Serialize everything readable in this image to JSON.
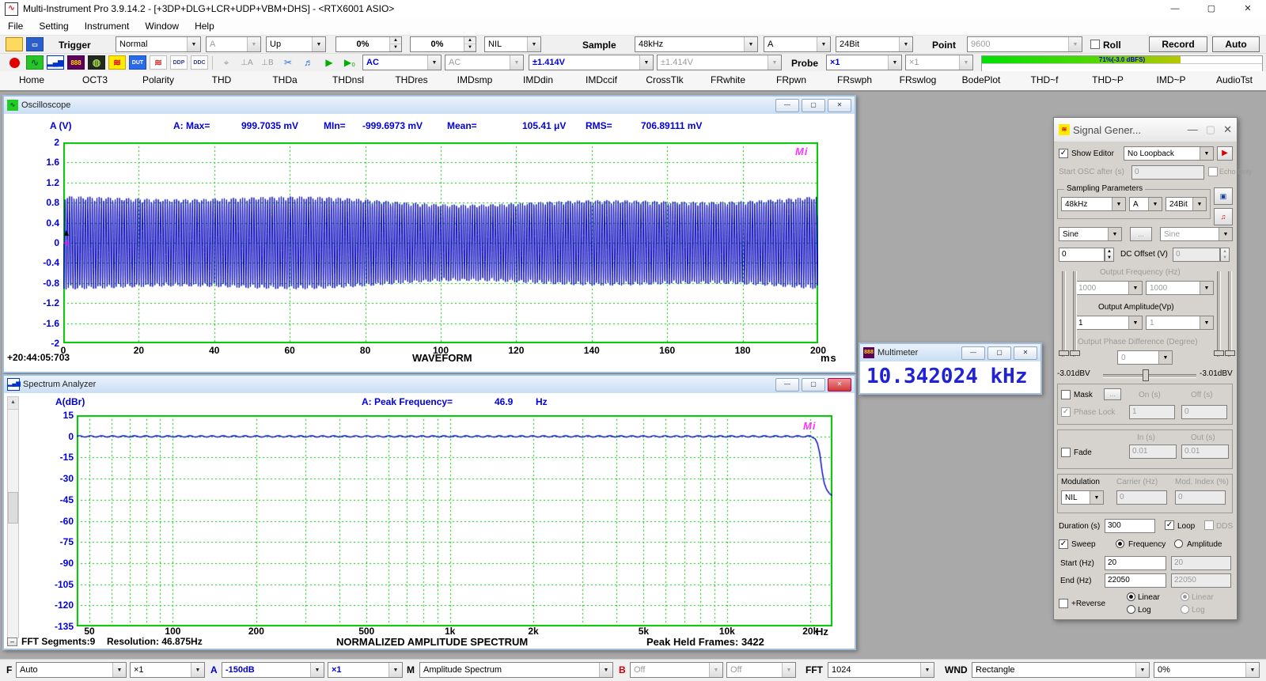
{
  "titlebar": {
    "title": "Multi-Instrument Pro 3.9.14.2  -  [+3DP+DLG+LCR+UDP+VBM+DHS]  -  <RTX6001 ASIO>"
  },
  "menu": {
    "items": [
      "File",
      "Setting",
      "Instrument",
      "Window",
      "Help"
    ]
  },
  "toolbar1": {
    "trigger_label": "Trigger",
    "trigger_mode": "Normal",
    "trigger_source": "A",
    "trigger_edge": "Up",
    "trigger_level": "0%",
    "trigger_delay": "0%",
    "trigger_hpf": "NIL",
    "sample_label": "Sample",
    "sample_rate": "48kHz",
    "sample_channel": "A",
    "sample_bits": "24Bit",
    "point_label": "Point",
    "point_value": "9600",
    "roll_label": "Roll",
    "record_label": "Record",
    "auto_label": "Auto"
  },
  "toolbar2": {
    "coupling_a": "AC",
    "coupling_b": "AC",
    "range_a": "±1.414V",
    "range_b": "±1.414V",
    "probe_label": "Probe",
    "probe_a": "×1",
    "probe_b": "×1",
    "level_meter": {
      "text": "71%(-3.0 dBFS)",
      "percent": 71
    }
  },
  "icons": {
    "multimeter": "888",
    "dut": "DUT",
    "ddp": "DDP",
    "ddc": "DDC",
    "ground_a": "⊥A",
    "ground_b": "⊥B"
  },
  "tabs": [
    "Home",
    "OCT3",
    "Polarity",
    "THD",
    "THDa",
    "THDnsl",
    "THDres",
    "IMDsmp",
    "IMDdin",
    "IMDccif",
    "CrossTlk",
    "FRwhite",
    "FRpwn",
    "FRswph",
    "FRswlog",
    "BodePlot",
    "THD~f",
    "THD~P",
    "IMD~P",
    "AudioTst"
  ],
  "osc": {
    "title": "Oscilloscope",
    "channel_label": "A (V)",
    "stats": {
      "max_label": "A: Max=",
      "max_value": "999.7035 mV",
      "min_label": "MIn=",
      "min_value": "-999.6973 mV",
      "mean_label": "Mean=",
      "mean_value": "105.41  μV",
      "rms_label": "RMS=",
      "rms_value": "706.89111 mV"
    },
    "x_title": "WAVEFORM",
    "x_unit": "ms",
    "timestamp": "+20:44:05:703",
    "logo": "Mi"
  },
  "spec": {
    "title": "Spectrum Analyzer",
    "channel_label": "A(dBr)",
    "peak_label": "A: Peak Frequency=",
    "peak_value": "46.9",
    "peak_unit": "Hz",
    "x_unit": "Hz",
    "footer_segments": "FFT Segments:9",
    "footer_resolution": "Resolution: 46.875Hz",
    "footer_title": "NORMALIZED AMPLITUDE SPECTRUM",
    "footer_peak_held": "Peak Held Frames: 3422",
    "logo": "Mi"
  },
  "multimeter": {
    "title": "Multimeter",
    "reading": "10.342024 kHz"
  },
  "siggen": {
    "title": "Signal Gener...",
    "show_editor": "Show Editor",
    "loopback": "No Loopback",
    "start_osc_label": "Start OSC after (s)",
    "start_osc_value": "0",
    "echo_only": "Echo Only",
    "sampling_group": "Sampling Parameters",
    "rate": "48kHz",
    "chan": "A",
    "bits": "24Bit",
    "wave_a": "Sine",
    "wave_b": "Sine",
    "more": "...",
    "dc_a": "0",
    "dc_label": "DC Offset (V)",
    "dc_b": "0",
    "freq_label": "Output Frequency (Hz)",
    "freq_a": "1000",
    "freq_b": "1000",
    "amp_label": "Output Amplitude(Vp)",
    "amp_a": "1",
    "amp_b": "1",
    "phase_label": "Output Phase Difference (Degree)",
    "phase_value": "0",
    "dbv_left": "-3.01dBV",
    "dbv_right": "-3.01dBV",
    "mask": "Mask",
    "on_s": "On (s)",
    "off_s": "Off (s)",
    "phase_lock": "Phase Lock",
    "mask_on": "1",
    "mask_off": "0",
    "fade": "Fade",
    "in_s": "In (s)",
    "out_s": "Out (s)",
    "fade_in": "0.01",
    "fade_out": "0.01",
    "modulation": "Modulation",
    "carrier_label": "Carrier (Hz)",
    "mod_index_label": "Mod. Index (%)",
    "mod_type": "NIL",
    "carrier_value": "0",
    "mod_index_value": "0",
    "duration_label": "Duration (s)",
    "duration": "300",
    "loop": "Loop",
    "dds": "DDS",
    "sweep": "Sweep",
    "frequency": "Frequency",
    "amplitude": "Amplitude",
    "start_label": "Start (Hz)",
    "start_a": "20",
    "start_b": "20",
    "end_label": "End (Hz)",
    "end_a": "22050",
    "end_b": "22050",
    "reverse": "+Reverse",
    "linear": "Linear",
    "log": "Log"
  },
  "statusbar": {
    "f_label": "F",
    "f_mode": "Auto",
    "f_probe": "×1",
    "a_label": "A",
    "a_range": "-150dB",
    "a_probe": "×1",
    "m_label": "M",
    "m_mode": "Amplitude Spectrum",
    "b_label": "B",
    "b_range": "Off",
    "b_probe": "Off",
    "fft_label": "FFT",
    "fft_size": "1024",
    "wnd_label": "WND",
    "wnd_type": "Rectangle",
    "overlap": "0%"
  },
  "chart_data": [
    {
      "type": "line",
      "title": "WAVEFORM",
      "xlabel": "ms",
      "x_range": [
        0,
        200
      ],
      "x_tick_step": 20,
      "ylabel": "A (V)",
      "y_range": [
        -2,
        2
      ],
      "y_tick_step": 0.4,
      "grid": "green-dashed",
      "series": [
        {
          "name": "A",
          "color": "#0000bb",
          "signal": "swept sine (display aliased)",
          "frequency_hz": 10342,
          "amplitude_vp": 1.0,
          "envelope_vp": [
            0.75,
            0.97
          ]
        }
      ],
      "stats": {
        "max_mV": 999.7035,
        "min_mV": -999.6973,
        "mean_uV": 105.41,
        "rms_mV": 706.89111
      }
    },
    {
      "type": "line",
      "title": "NORMALIZED AMPLITUDE SPECTRUM",
      "xlabel": "Hz",
      "x_scale": "log",
      "x_range": [
        45,
        24000
      ],
      "x_ticks": [
        50,
        100,
        200,
        500,
        1000,
        2000,
        5000,
        10000,
        20000
      ],
      "ylabel": "A(dBr)",
      "y_range": [
        -135,
        15
      ],
      "y_tick_step": 15,
      "peak_frequency_hz": 46.9,
      "series": [
        {
          "name": "A",
          "color": "#0000bb",
          "points": [
            [
              45,
              0
            ],
            [
              1000,
              0
            ],
            [
              5000,
              0
            ],
            [
              10000,
              0
            ],
            [
              15000,
              0
            ],
            [
              20000,
              0
            ],
            [
              20700,
              -1
            ],
            [
              21200,
              -5
            ],
            [
              21600,
              -12
            ],
            [
              22000,
              -24
            ],
            [
              22400,
              -33
            ],
            [
              22900,
              -38
            ],
            [
              23500,
              -41
            ],
            [
              24000,
              -42
            ]
          ]
        }
      ]
    }
  ]
}
